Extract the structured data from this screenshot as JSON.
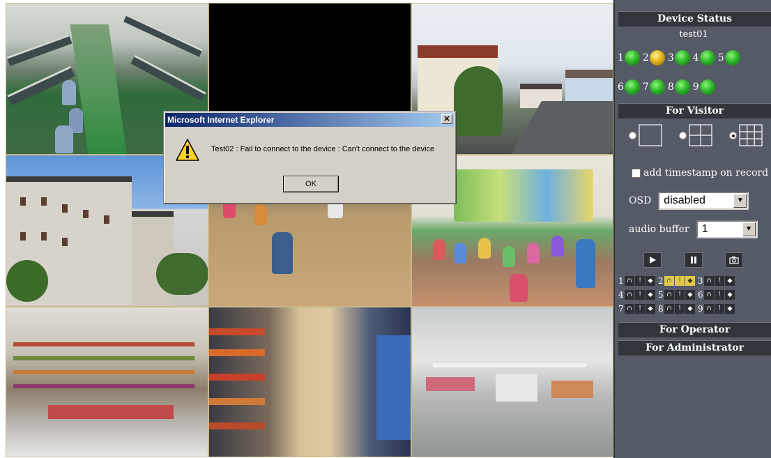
{
  "dialog": {
    "title": "Microsoft Internet Explorer",
    "close_glyph": "✕",
    "message": "Test02 : Fail to connect to the device : Can't connect to the device",
    "ok_label": "OK"
  },
  "panel": {
    "device_status": {
      "title": "Device Status",
      "device_name": "test01",
      "channels": [
        {
          "num": "1",
          "status": "green"
        },
        {
          "num": "2",
          "status": "yellow"
        },
        {
          "num": "3",
          "status": "green"
        },
        {
          "num": "4",
          "status": "green"
        },
        {
          "num": "5",
          "status": "green"
        },
        {
          "num": "6",
          "status": "green"
        },
        {
          "num": "7",
          "status": "green"
        },
        {
          "num": "8",
          "status": "green"
        },
        {
          "num": "9",
          "status": "green"
        }
      ]
    },
    "visitor": {
      "title": "For Visitor",
      "layouts": [
        "1x1",
        "2x2",
        "3x3"
      ],
      "selected_layout": "3x3",
      "timestamp_label": "add timestamp on record",
      "timestamp_checked": false,
      "osd_label": "OSD",
      "osd_value": "disabled",
      "audio_buffer_label": "audio buffer",
      "audio_buffer_value": "1",
      "controls": [
        "play-icon",
        "pause-icon",
        "snapshot-icon"
      ],
      "channel_controls": [
        {
          "num": "1",
          "active": false
        },
        {
          "num": "2",
          "active": true
        },
        {
          "num": "3",
          "active": false
        },
        {
          "num": "4",
          "active": false
        },
        {
          "num": "5",
          "active": false
        },
        {
          "num": "6",
          "active": false
        },
        {
          "num": "7",
          "active": false
        },
        {
          "num": "8",
          "active": false
        },
        {
          "num": "9",
          "active": false
        }
      ]
    },
    "operator_title": "For Operator",
    "administrator_title": "For Administrator"
  },
  "colors": {
    "panel_bg": "#545a66",
    "header_bg": "#32353b",
    "led_green": "#2fb82a",
    "led_yellow": "#e2b41a",
    "dialog_title_bg": "#0a246a"
  }
}
